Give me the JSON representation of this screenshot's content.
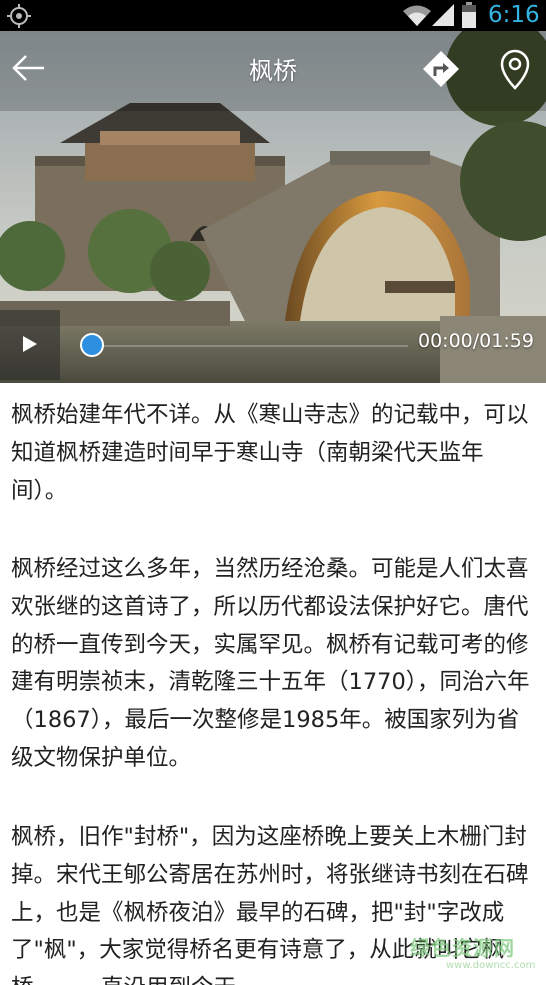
{
  "status_bar": {
    "time": "6:16",
    "icons": [
      "location-icon",
      "wifi-icon",
      "signal-icon",
      "battery-icon"
    ]
  },
  "header": {
    "title": "枫桥",
    "back_icon": "arrow-left-icon",
    "navigate_icon": "route-turn-icon",
    "location_icon": "map-pin-icon"
  },
  "player": {
    "time": "00:00/01:59",
    "progress": 0,
    "accent_color": "#2d8fe0"
  },
  "article": {
    "paragraphs": [
      "枫桥始建年代不详。从《寒山寺志》的记载中，可以知道枫桥建造时间早于寒山寺（南朝梁代天监年间）。",
      "枫桥经过这么多年，当然历经沧桑。可能是人们太喜欢张继的这首诗了，所以历代都设法保护好它。唐代的桥一直传到今天，实属罕见。枫桥有记载可考的修建有明崇祯末，清乾隆三十五年（1770），同治六年（1867），最后一次整修是1985年。被国家列为省级文物保护单位。",
      "枫桥，旧作\"封桥\"，因为这座桥晚上要关上木栅门封掉。宋代王郇公寄居在苏州时，将张继诗书刻在石碑上，也是《枫桥夜泊》最早的石碑，把\"封\"字改成了\"枫\"，大家觉得桥名更有诗意了，从此就叫它枫桥。……直沿用到今天。"
    ]
  },
  "watermark": {
    "text": "绿色资源网",
    "url": "www.downcc.com"
  }
}
